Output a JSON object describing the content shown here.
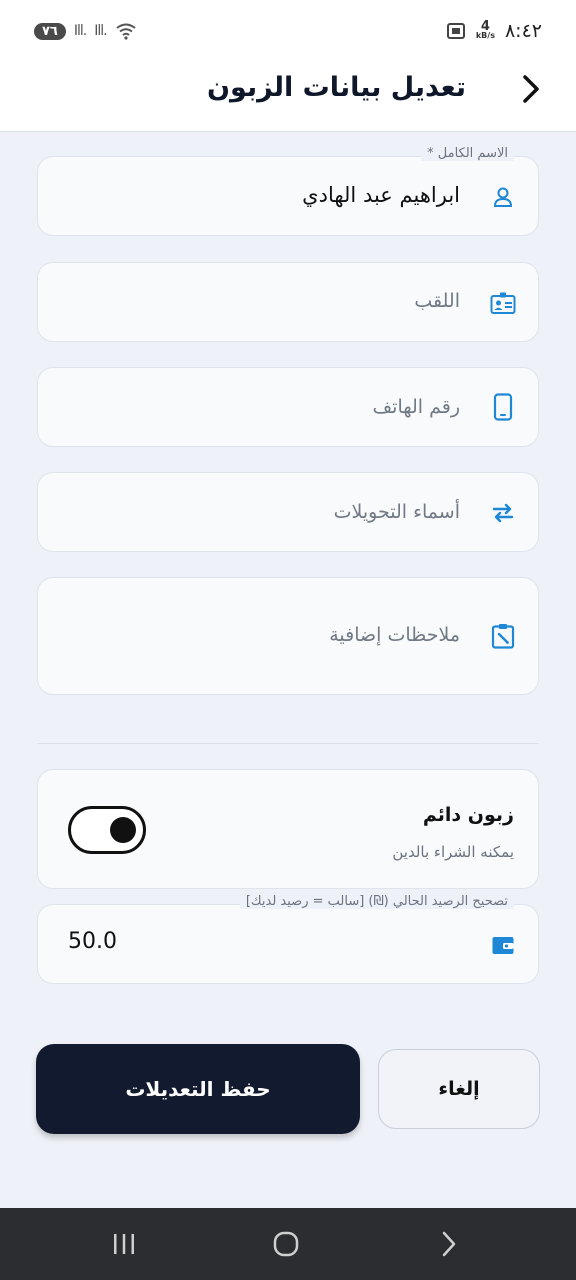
{
  "status_bar": {
    "time": "٨:٤٢",
    "net_speed_value": "4",
    "net_speed_unit": "kB/s",
    "battery": "٧٦",
    "signal_1": "Ill.",
    "signal_2": "Ill."
  },
  "header": {
    "title": "تعديل بيانات الزبون"
  },
  "form": {
    "full_name": {
      "label": "الاسم الكامل *",
      "value": "ابراهيم عبد الهادي",
      "icon": "person-icon"
    },
    "nickname": {
      "placeholder": "اللقب",
      "icon": "id-card-icon"
    },
    "phone": {
      "placeholder": "رقم الهاتف",
      "icon": "phone-icon"
    },
    "transfer_names": {
      "placeholder": "أسماء التحويلات",
      "icon": "swap-arrows-icon"
    },
    "notes": {
      "placeholder": "ملاحظات إضافية",
      "icon": "clipboard-edit-icon"
    }
  },
  "permanent_customer": {
    "label": "زبون دائم",
    "description": "يمكنه الشراء بالدين",
    "enabled": true
  },
  "balance": {
    "label": "تصحيح الرصيد الحالي (₪)  [سالب = رصيد لديك]",
    "value": "50.0",
    "icon": "wallet-icon"
  },
  "actions": {
    "save_label": "حفظ التعديلات",
    "cancel_label": "إلغاء"
  },
  "colors": {
    "accent": "#1e88d6",
    "primary_button": "#111a2e",
    "background": "#eef1f7"
  }
}
